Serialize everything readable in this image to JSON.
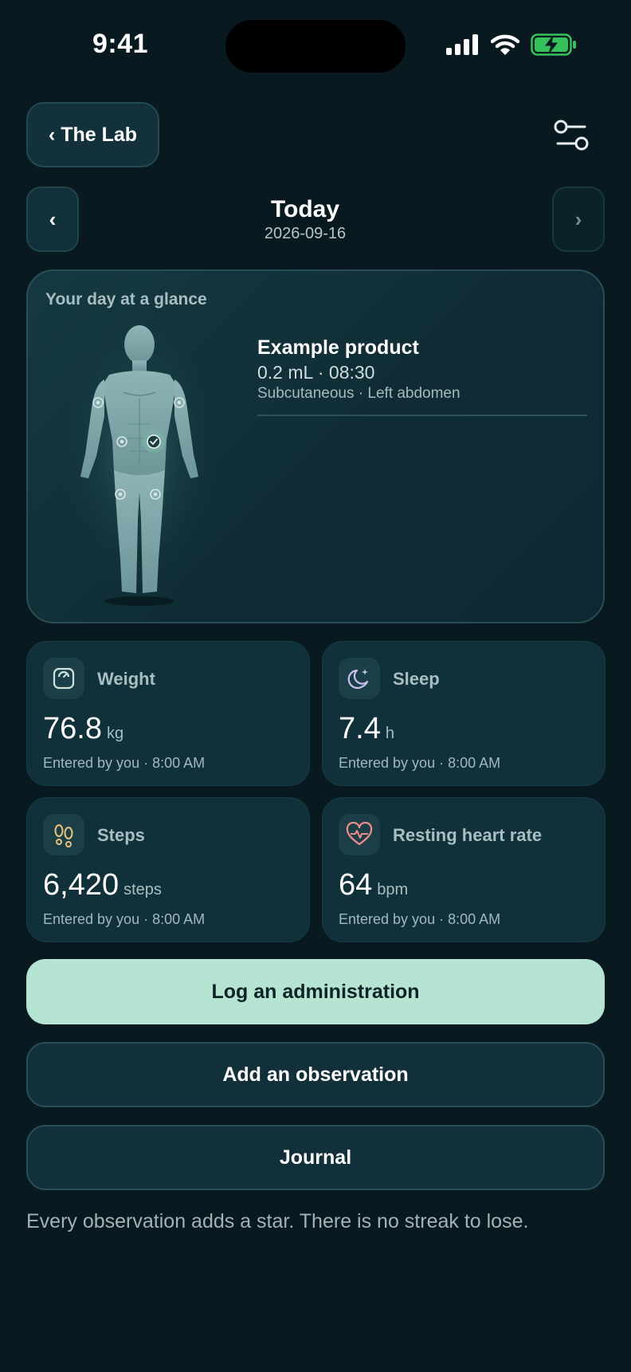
{
  "status_bar": {
    "time": "9:41"
  },
  "header": {
    "back_label": "‹ The Lab",
    "filter_icon": "sliders-icon"
  },
  "day_nav": {
    "prev": "‹",
    "next": "›",
    "title": "Today",
    "date": "2026-09-16"
  },
  "glance": {
    "title": "Your day at a glance",
    "product_name": "Example product",
    "dose_time": "0.2 mL · 08:30",
    "route_site": "Subcutaneous · Left abdomen"
  },
  "metrics": [
    {
      "label": "Weight",
      "value": "76.8",
      "unit": "kg",
      "entered": "Entered by you · 8:00 AM",
      "icon": "scale-icon"
    },
    {
      "label": "Sleep",
      "value": "7.4",
      "unit": "h",
      "entered": "Entered by you · 8:00 AM",
      "icon": "moon-icon"
    },
    {
      "label": "Steps",
      "value": "6,420",
      "unit": "steps",
      "entered": "Entered by you · 8:00 AM",
      "icon": "footprints-icon"
    },
    {
      "label": "Resting heart rate",
      "value": "64",
      "unit": "bpm",
      "entered": "Entered by you · 8:00 AM",
      "icon": "heart-pulse-icon"
    }
  ],
  "actions": {
    "log": "Log an administration",
    "observation": "Add an observation",
    "journal": "Journal"
  },
  "footer": "Every observation adds a star. There is no streak to lose.",
  "colors": {
    "background": "#081a20",
    "accent": "#b5e4d3",
    "card": "#10303a"
  }
}
